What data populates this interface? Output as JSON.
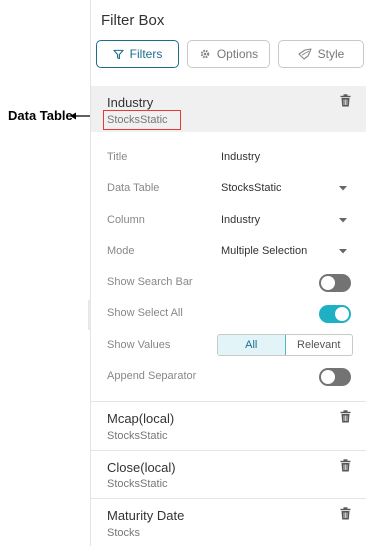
{
  "annotation": {
    "label": "Data Table"
  },
  "panel": {
    "title": "Filter Box"
  },
  "tabs": [
    {
      "label": "Filters",
      "icon": "filter-icon",
      "active": true
    },
    {
      "label": "Options",
      "icon": "gear-icon",
      "active": false
    },
    {
      "label": "Style",
      "icon": "style-icon",
      "active": false
    }
  ],
  "sections": [
    {
      "title": "Industry",
      "subtitle": "StocksStatic",
      "icon": "trash-icon"
    },
    {
      "title": "Mcap(local)",
      "subtitle": "StocksStatic",
      "icon": "trash-icon"
    },
    {
      "title": "Close(local)",
      "subtitle": "StocksStatic",
      "icon": "trash-icon"
    },
    {
      "title": "Maturity Date",
      "subtitle": "Stocks",
      "icon": "trash-icon"
    }
  ],
  "settings": {
    "title": {
      "label": "Title",
      "value": "Industry"
    },
    "data_table": {
      "label": "Data Table",
      "value": "StocksStatic"
    },
    "column": {
      "label": "Column",
      "value": "Industry"
    },
    "mode": {
      "label": "Mode",
      "value": "Multiple Selection"
    },
    "show_search_bar": {
      "label": "Show Search Bar",
      "on": false
    },
    "show_select_all": {
      "label": "Show Select All",
      "on": true
    },
    "show_values": {
      "label": "Show Values",
      "options": [
        "All",
        "Relevant"
      ],
      "selected": "All"
    },
    "append_separator": {
      "label": "Append Separator",
      "on": false
    }
  },
  "colors": {
    "accent": "#1c6d8c",
    "toggle_on": "#1fb1c3",
    "highlight": "#e53935"
  }
}
